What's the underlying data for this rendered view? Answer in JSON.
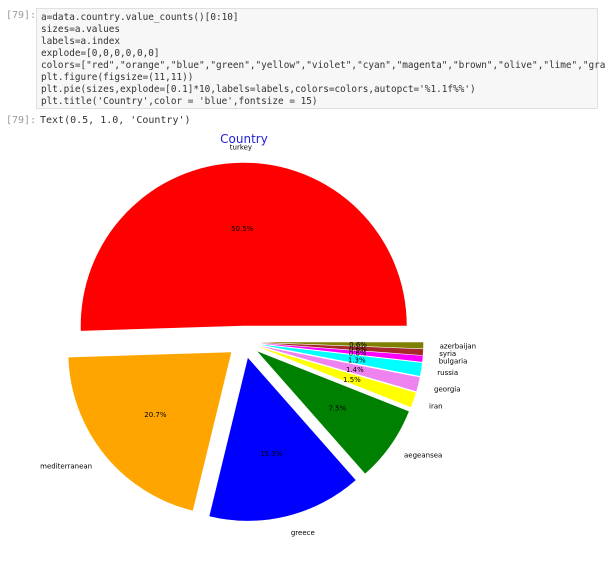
{
  "cell_in": {
    "prompt": "[79]:",
    "code": [
      "a=data.country.value_counts()[0:10]",
      "sizes=a.values",
      "labels=a.index",
      "explode=[0,0,0,0,0,0]",
      "colors=[\"red\",\"orange\",\"blue\",\"green\",\"yellow\",\"violet\",\"cyan\",\"magenta\",\"brown\",\"olive\",\"lime\",\"gray\"]",
      "plt.figure(figsize=(11,11))",
      "plt.pie(sizes,explode=[0.1]*10,labels=labels,colors=colors,autopct='%1.1f%%')",
      "plt.title('Country',color = 'blue',fontsize = 15)"
    ]
  },
  "cell_out": {
    "prompt": "[79]:",
    "text": "Text(0.5, 1.0, 'Country')"
  },
  "chart_data": {
    "type": "pie",
    "title": "Country",
    "title_color": "#1f1fd6",
    "slices": [
      {
        "label": "turkey",
        "value": 50.5,
        "pct_label": "50.5%",
        "color": "#ff0000"
      },
      {
        "label": "mediterranean",
        "value": 20.7,
        "pct_label": "20.7%",
        "color": "#ffa500"
      },
      {
        "label": "greece",
        "value": 15.3,
        "pct_label": "15.3%",
        "color": "#0000ff"
      },
      {
        "label": "aegeansea",
        "value": 7.5,
        "pct_label": "7.5%",
        "color": "#008000"
      },
      {
        "label": "iran",
        "value": 1.5,
        "pct_label": "1.5%",
        "color": "#ffff00"
      },
      {
        "label": "georgia",
        "value": 1.4,
        "pct_label": "1.4%",
        "color": "#ee82ee"
      },
      {
        "label": "russia",
        "value": 1.3,
        "pct_label": "1.3%",
        "color": "#00ffff"
      },
      {
        "label": "bulgaria",
        "value": 0.6,
        "pct_label": "0.6%",
        "color": "#ff00ff"
      },
      {
        "label": "syria",
        "value": 0.6,
        "pct_label": "0.6%",
        "color": "#a52a2a"
      },
      {
        "label": "azerbaijan",
        "value": 0.6,
        "pct_label": "0.6%",
        "color": "#808000"
      }
    ]
  }
}
